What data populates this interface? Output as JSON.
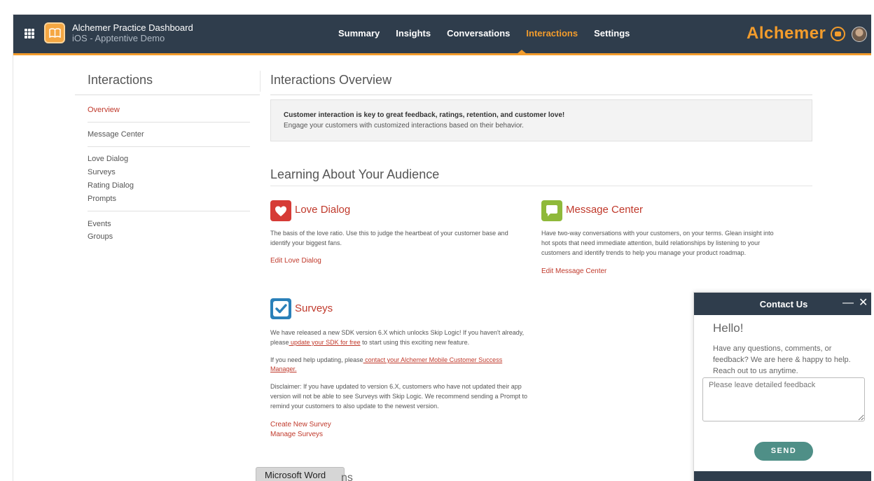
{
  "header": {
    "app_title": "Alchemer Practice Dashboard",
    "app_subtitle": "iOS - Apptentive Demo",
    "nav": [
      "Summary",
      "Insights",
      "Conversations",
      "Interactions",
      "Settings"
    ],
    "active_nav": "Interactions",
    "brand": "Alchemer",
    "accent_color": "#f39c2c",
    "bar_color": "#2f3d4c"
  },
  "sidebar": {
    "title": "Interactions",
    "items": [
      {
        "label": "Overview",
        "active": true
      },
      {
        "label": "Message Center"
      },
      {
        "label": "Love Dialog"
      },
      {
        "label": "Surveys"
      },
      {
        "label": "Rating Dialog"
      },
      {
        "label": "Prompts"
      },
      {
        "label": "Events"
      },
      {
        "label": "Groups"
      }
    ]
  },
  "main": {
    "title": "Interactions Overview",
    "info_strong": "Customer interaction is key to great feedback, ratings, retention, and customer love!",
    "info_sub": "Engage your customers with customized interactions based on their behavior.",
    "section_title": "Learning About Your Audience",
    "love": {
      "title": "Love Dialog",
      "desc_1": "The basis of the love ratio. Use this to judge the heartbeat of your customer base and",
      "desc_2": "identify your biggest fans.",
      "link": "Edit Love Dialog",
      "color": "#d63b36"
    },
    "message": {
      "title": "Message Center",
      "desc_1": "Have two-way conversations with your customers, on your terms. Glean insight into",
      "desc_2": "hot spots that need immediate attention, build relationships by listening to your",
      "desc_3": "customers and identify trends to help you manage your product roadmap.",
      "link": "Edit Message Center",
      "color": "#8fb93a"
    },
    "surveys": {
      "title": "Surveys",
      "p1_1": "We have released a new SDK version 6.X which unlocks Skip Logic! If you haven't already,",
      "p1_2a": "please",
      "p1_2_link": " update your SDK for free",
      "p1_2b": " to start using this exciting new feature.",
      "p2_1a": "If you need help updating, please",
      "p2_1_link": " contact your Alchemer Mobile Customer Success",
      "p2_2_link": "Manager.",
      "p3_1": "Disclaimer: If you have updated to version 6.X, customers who have not updated  their app",
      "p3_2": "version will not be able to see Surveys with Skip Logic. We recommend  sending a Prompt to",
      "p3_3": "remind your customers to also update to the newest version.",
      "link_create": "Create New Survey",
      "link_manage": "Manage Surveys",
      "color": "#2a80b9"
    }
  },
  "contact": {
    "title": "Contact Us",
    "min_glyph": "—",
    "close_glyph": "✕",
    "hello": "Hello!",
    "message": "Have any questions, comments, or feedback? We are here & happy to help. Reach out to us anytime.",
    "placeholder": "Please leave detailed feedback",
    "send": "SEND"
  },
  "tooltip": {
    "text": "Microsoft Word",
    "ghost": "ns"
  }
}
